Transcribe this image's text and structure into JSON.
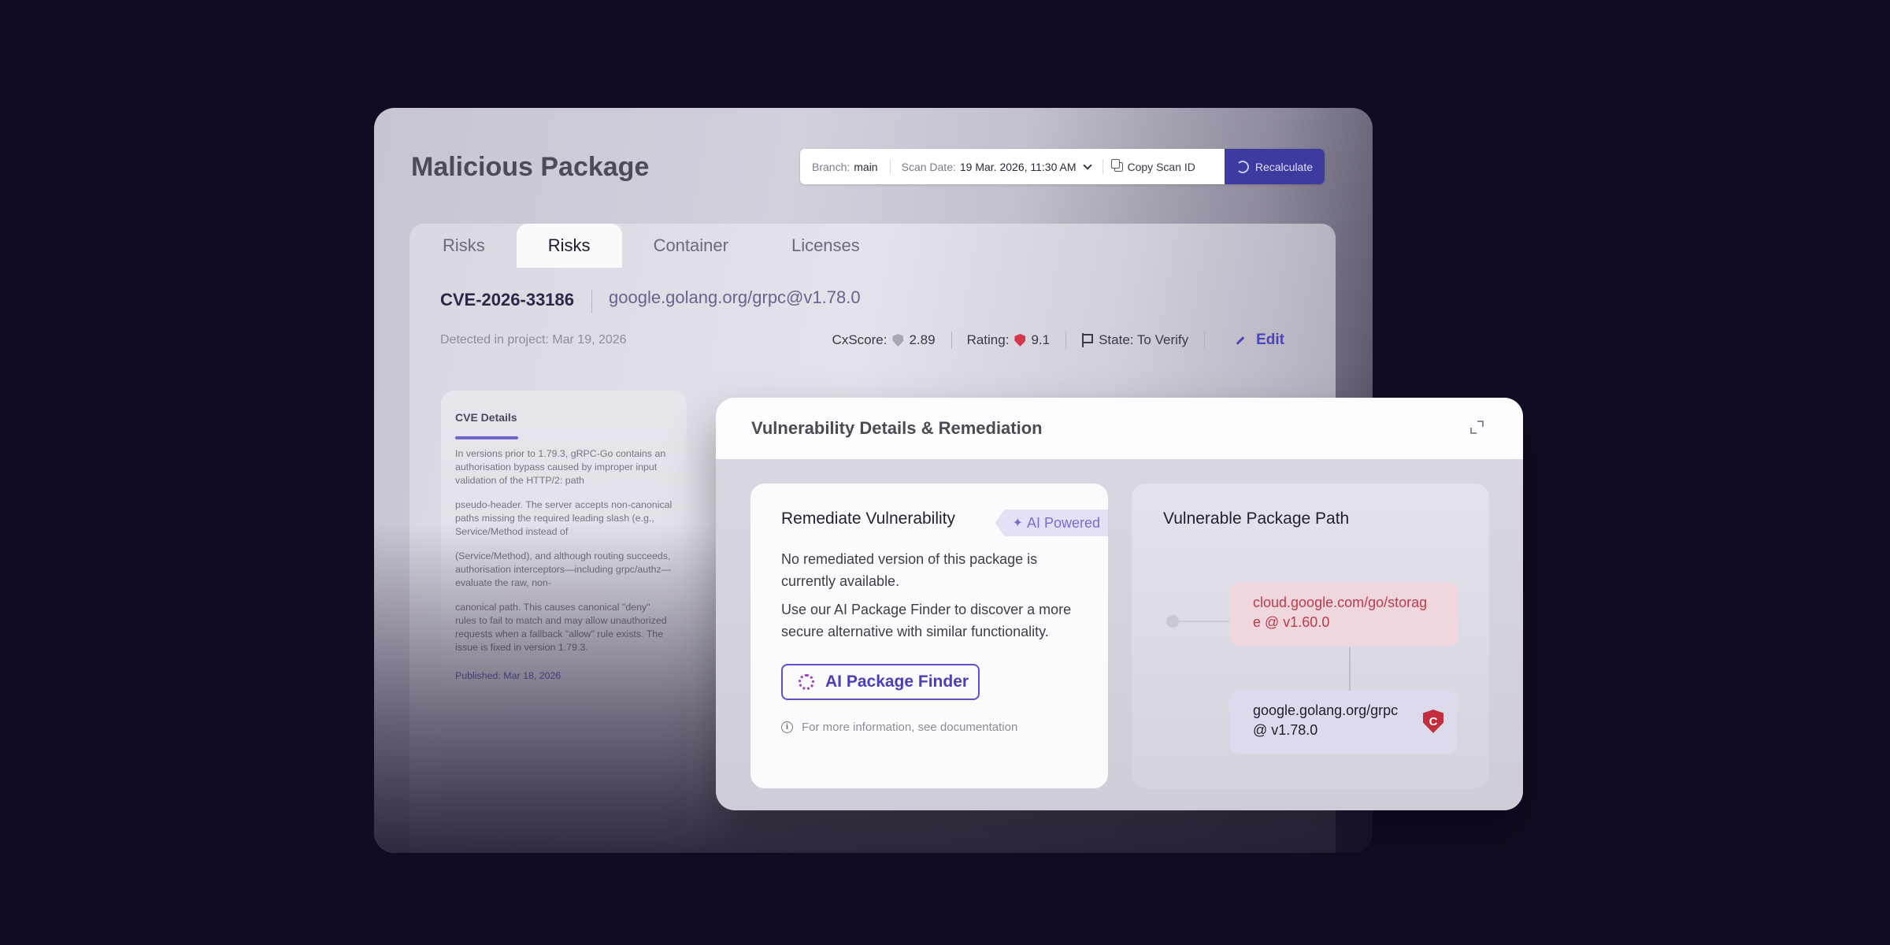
{
  "page": {
    "title": "Malicious Package"
  },
  "toolbar": {
    "branch_label": "Branch:",
    "branch_value": "main",
    "scan_label": "Scan Date:",
    "scan_value": "19 Mar. 2026, 11:30 AM",
    "copy_label": "Copy Scan ID",
    "recalc_label": "Recalculate"
  },
  "tabs": [
    {
      "label": "Risks",
      "active": false
    },
    {
      "label": "Risks",
      "active": true
    },
    {
      "label": "Container",
      "active": false
    },
    {
      "label": "Licenses",
      "active": false
    }
  ],
  "vuln": {
    "id": "CVE-2026-33186",
    "package": "google.golang.org/grpc@v1.78.0",
    "detected": "Detected in project: Mar 19, 2026",
    "cxscore_label": "CxScore:",
    "cxscore_value": "2.89",
    "rating_label": "Rating:",
    "rating_value": "9.1",
    "state": "State: To Verify",
    "edit_label": "Edit"
  },
  "cve_details": {
    "title": "CVE Details",
    "paragraphs": [
      "In versions prior to 1.79.3, gRPC-Go contains an authorisation bypass caused by improper input validation of the HTTP/2: path",
      "pseudo-header. The server accepts non-canonical paths missing the required leading slash (e.g., Service/Method instead of",
      "(Service/Method), and although routing succeeds, authorisation interceptors—including grpc/authz—evaluate the raw, non-",
      "canonical path. This causes canonical \"deny\" rules to fail to match and may allow unauthorized requests when a fallback \"allow\" rule exists. The issue is fixed in version 1.79.3."
    ],
    "published": "Published: Mar 18, 2026"
  },
  "modal": {
    "title": "Vulnerability Details & Remediation",
    "remediate": {
      "title": "Remediate Vulnerability",
      "ai_badge": "AI Powered",
      "text1": "No remediated version of this package is currently available.",
      "text2": "Use our AI Package Finder to discover a more secure alternative with similar functionality.",
      "button": "AI Package Finder",
      "info": "For more information, see documentation"
    },
    "path": {
      "title": "Vulnerable Package Path",
      "node1": "cloud.google.com/go/storage @ v1.60.0",
      "node2": "google.golang.org/grpc @ v1.78.0",
      "node2_badge": "C"
    }
  },
  "colors": {
    "background": "#150a24",
    "accent": "#3d3aa0",
    "danger": "#c13a4c"
  }
}
